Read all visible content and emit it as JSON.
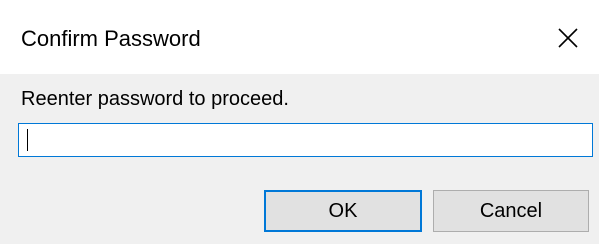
{
  "dialog": {
    "title": "Confirm Password",
    "close_icon": "close-icon",
    "prompt": "Reenter password to proceed.",
    "password_field": {
      "value": "",
      "placeholder": ""
    },
    "buttons": {
      "ok_label": "OK",
      "cancel_label": "Cancel"
    }
  },
  "colors": {
    "accent": "#0078d7",
    "body_bg": "#f0f0f0",
    "button_bg": "#e1e1e1"
  }
}
